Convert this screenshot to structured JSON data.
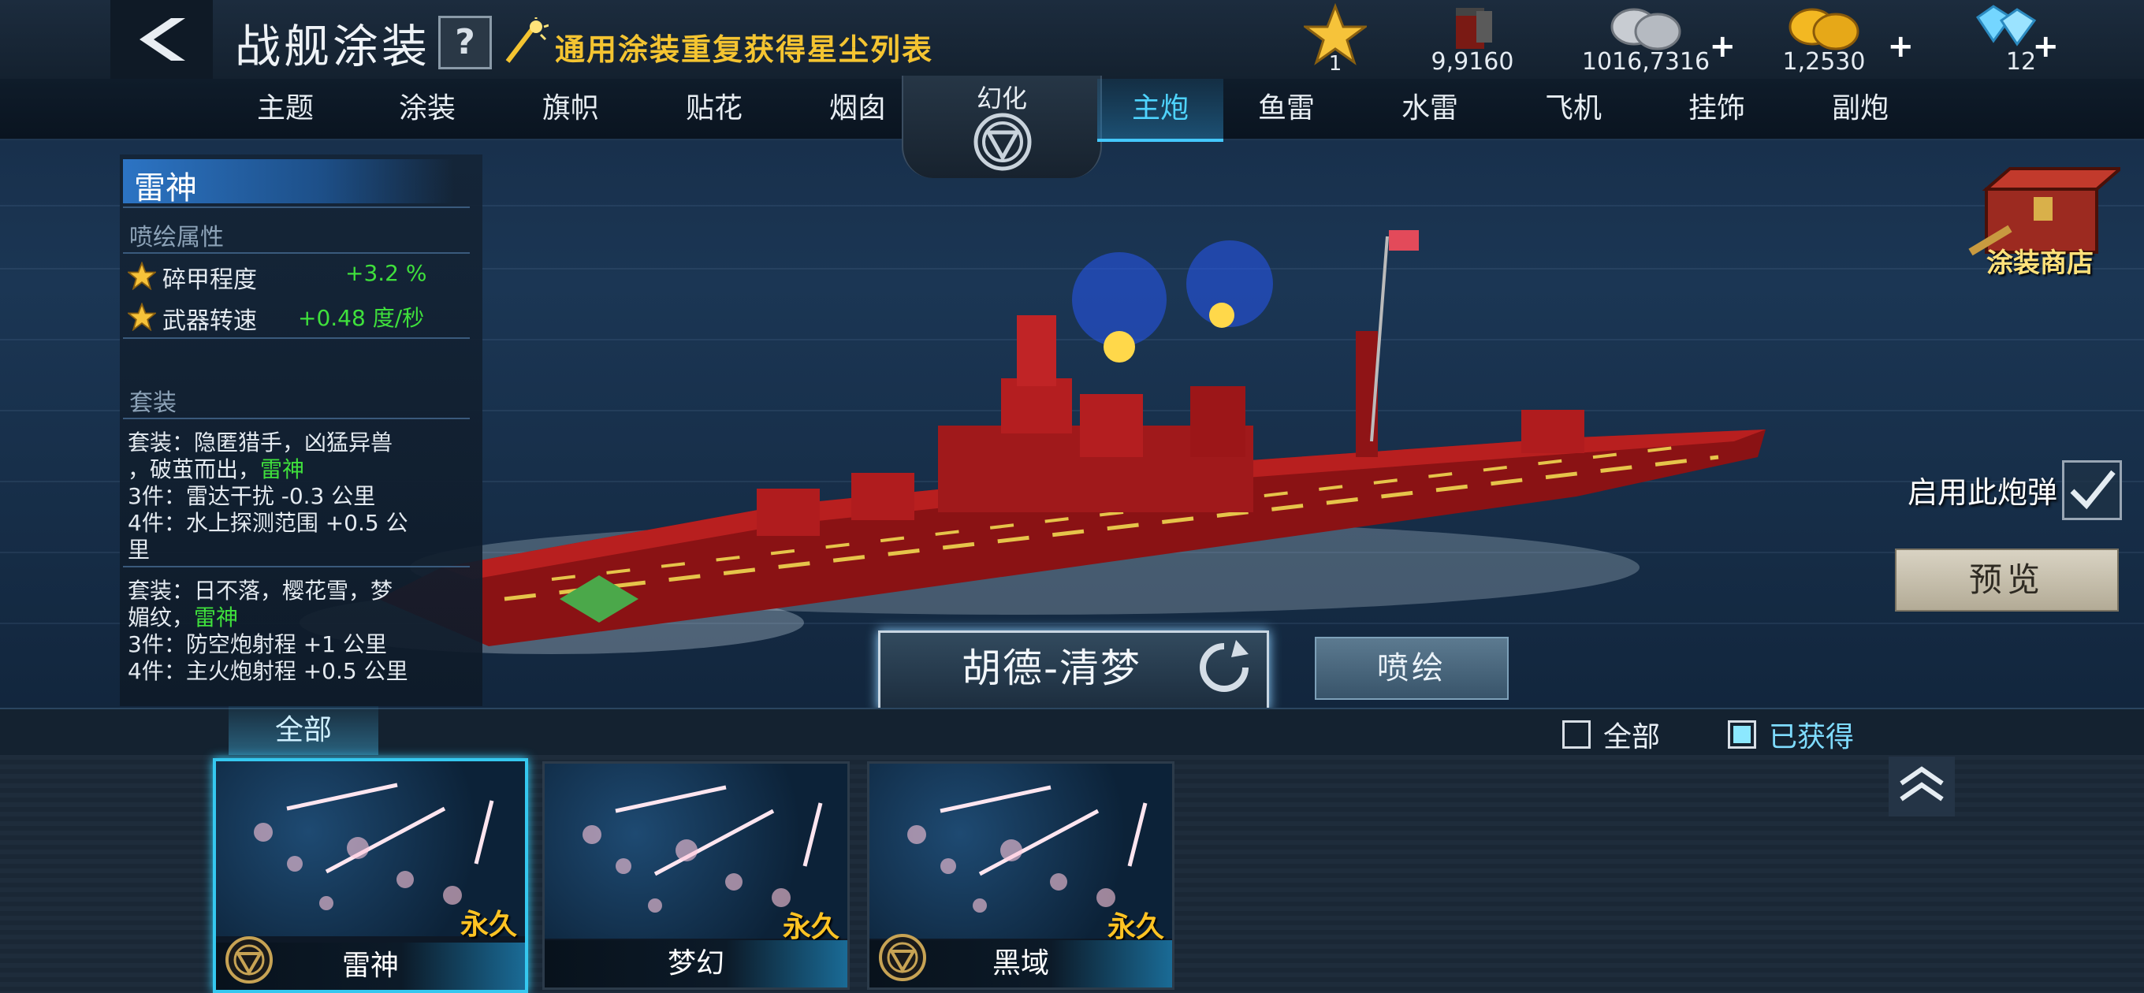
{
  "header": {
    "title": "战舰涂装",
    "help_label": "?",
    "stardust_link": "通用涂装重复获得星尘列表"
  },
  "resources": [
    {
      "icon": "star-icon",
      "value": "1"
    },
    {
      "icon": "paint-bucket-icon",
      "value": "9,9160"
    },
    {
      "icon": "silver-coins-icon",
      "value": "1016,7316",
      "plus": "+"
    },
    {
      "icon": "gold-coins-icon",
      "value": "1,2530",
      "plus": "+"
    },
    {
      "icon": "diamond-icon",
      "value": "12",
      "plus": "+"
    }
  ],
  "tabs": {
    "theme": "主题",
    "paint": "涂装",
    "flag": "旗帜",
    "decal": "贴花",
    "funnel": "烟囱",
    "illusion": "幻化",
    "main_gun": "主炮",
    "torpedo": "鱼雷",
    "mine": "水雷",
    "aircraft": "飞机",
    "ornament": "挂饰",
    "secondary_gun": "副炮",
    "active": "主炮"
  },
  "info_panel": {
    "skin_name": "雷神",
    "attr_header": "喷绘属性",
    "attributes": [
      {
        "label": "碎甲程度",
        "value": "+3.2 %"
      },
      {
        "label": "武器转速",
        "value": "+0.48 度/秒"
      }
    ],
    "set_header": "套装",
    "set1_line1": "套装：隐匿猎手，凶猛异兽",
    "set1_line2a": "，破茧而出，",
    "set1_line2b": "雷神",
    "set1_line3": "3件：雷达干扰 -0.3 公里",
    "set1_line4": "4件：水上探测范围 +0.5 公",
    "set1_line5": "里",
    "set2_line1": "套装：日不落，樱花雪，梦",
    "set2_line2a": "媚纹，",
    "set2_line2b": "雷神",
    "set2_line3": "3件：防空炮射程 +1 公里",
    "set2_line4": "4件：主火炮射程 +0.5 公里"
  },
  "shop_label": "涂装商店",
  "ammo_label": "启用此炮弹",
  "preview_button": "预览",
  "ship_name": "胡德-清梦",
  "spray_button": "喷绘",
  "filter": {
    "tab_all": "全部",
    "check_all": "全部",
    "check_owned": "已获得"
  },
  "cards": [
    {
      "name": "雷神",
      "tag": "永久",
      "badge": true,
      "selected": true
    },
    {
      "name": "梦幻",
      "tag": "永久",
      "badge": false,
      "selected": false
    },
    {
      "name": "黑域",
      "tag": "永久",
      "badge": true,
      "selected": false
    }
  ],
  "colors": {
    "accent": "#44c8ff",
    "bonus_green": "#3fe03c",
    "gold_text": "#f4c431",
    "permanent_tag": "#ffc323"
  }
}
